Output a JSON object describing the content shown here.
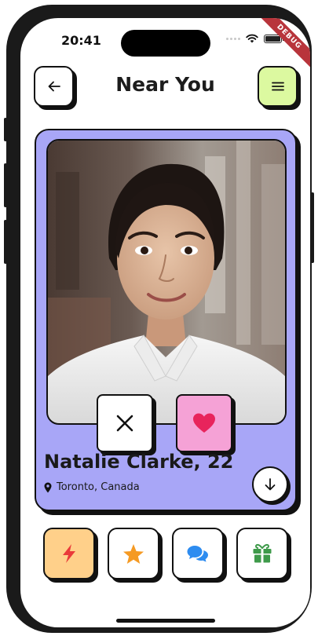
{
  "status_bar": {
    "time": "20:41",
    "debug_banner": "DEBUG"
  },
  "header": {
    "title": "Near You",
    "back_icon": "arrow-left-icon",
    "menu_icon": "menu-icon"
  },
  "profile": {
    "name": "Natalie Clarke, 22",
    "location": "Toronto, Canada",
    "location_icon": "map-pin-icon",
    "photo_alt": "Profile photo"
  },
  "actions": {
    "dislike_icon": "close-icon",
    "like_icon": "heart-icon",
    "more_icon": "arrow-down-icon"
  },
  "bottom_bar": [
    {
      "icon": "bolt-icon",
      "bg": "#ffd08a",
      "color": "#ea3a3a"
    },
    {
      "icon": "star-icon",
      "bg": "#ffffff",
      "color": "#f59a23"
    },
    {
      "icon": "chat-icon",
      "bg": "#ffffff",
      "color": "#2d8cf0"
    },
    {
      "icon": "gift-icon",
      "bg": "#ffffff",
      "color": "#3e9a4a"
    }
  ],
  "colors": {
    "card_bg": "#a8a6f7",
    "menu_bg": "#dcf9a0",
    "like_bg": "#f5a2d6",
    "heart": "#e8245c"
  }
}
